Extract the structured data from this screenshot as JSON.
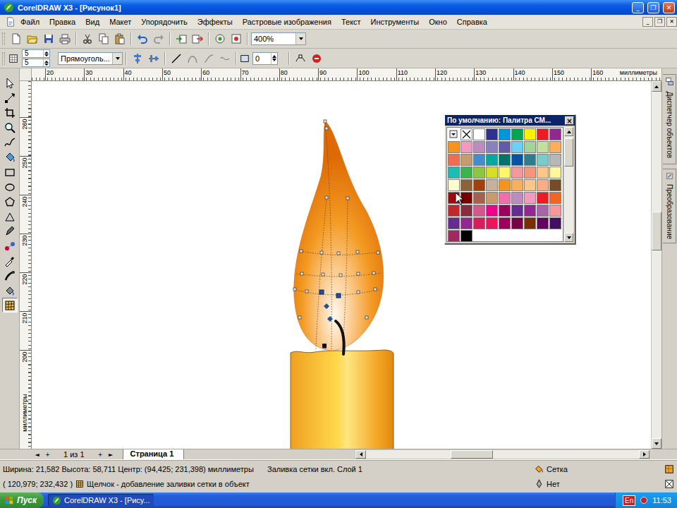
{
  "window": {
    "title": "CorelDRAW X3 - [Рисунок1]",
    "controls": [
      "_",
      "❐",
      "✕"
    ]
  },
  "menu": {
    "items": [
      "Файл",
      "Правка",
      "Вид",
      "Макет",
      "Упорядочить",
      "Эффекты",
      "Растровые изображения",
      "Текст",
      "Инструменты",
      "Окно",
      "Справка"
    ],
    "doc_controls": [
      "_",
      "❐",
      "✕"
    ]
  },
  "toolbar": {
    "zoom": "400%"
  },
  "property_bar": {
    "width_field": "5",
    "height_field": "5",
    "shape": "Прямоуголь...",
    "angle": "0"
  },
  "rulers": {
    "horizontal": [
      "20",
      "30",
      "40",
      "50",
      "60",
      "70",
      "80",
      "90",
      "100",
      "110",
      "120",
      "130",
      "140",
      "150",
      "160"
    ],
    "horizontal_unit": "миллиметры",
    "vertical": [
      "260",
      "250",
      "240",
      "230",
      "220",
      "210",
      "200"
    ],
    "vertical_unit": "миллиметры"
  },
  "toolbox": [
    {
      "selected": false
    },
    {
      "selected": false
    },
    {
      "selected": false
    },
    {
      "selected": false
    },
    {
      "selected": false
    },
    {
      "selected": false
    },
    {
      "selected": false
    },
    {
      "selected": false
    },
    {
      "selected": false
    },
    {
      "selected": false
    },
    {
      "selected": false
    },
    {
      "selected": false
    },
    {
      "selected": false
    },
    {
      "selected": false
    },
    {
      "selected": false
    },
    {
      "selected": true
    }
  ],
  "palette": {
    "title": "По умолчанию: Палитра СМ...",
    "close": "×",
    "swatches": [
      {
        "kind": "picker"
      },
      {
        "kind": "none"
      },
      {
        "kind": "color",
        "color": "#ffffff"
      },
      {
        "kind": "color",
        "color": "#2e3192"
      },
      {
        "kind": "color",
        "color": "#0096db"
      },
      {
        "kind": "color",
        "color": "#00a651"
      },
      {
        "kind": "color",
        "color": "#fff200"
      },
      {
        "kind": "color",
        "color": "#ed1c24"
      },
      {
        "kind": "color",
        "color": "#92278f"
      },
      {
        "kind": "color",
        "color": "#f7941d"
      },
      {
        "kind": "color",
        "color": "#f49ac1"
      },
      {
        "kind": "color",
        "color": "#bd8cbf"
      },
      {
        "kind": "color",
        "color": "#8781bd"
      },
      {
        "kind": "color",
        "color": "#605ca8"
      },
      {
        "kind": "color",
        "color": "#6dcff6"
      },
      {
        "kind": "color",
        "color": "#a3d39c"
      },
      {
        "kind": "color",
        "color": "#c4df9b"
      },
      {
        "kind": "color",
        "color": "#fbaf5d"
      },
      {
        "kind": "color",
        "color": "#f26c4f"
      },
      {
        "kind": "color",
        "color": "#c69c6d"
      },
      {
        "kind": "color",
        "color": "#448ccb"
      },
      {
        "kind": "color",
        "color": "#00a99d"
      },
      {
        "kind": "color",
        "color": "#00746b"
      },
      {
        "kind": "color",
        "color": "#0054a6"
      },
      {
        "kind": "color",
        "color": "#2e7d8c"
      },
      {
        "kind": "color",
        "color": "#7accc8"
      },
      {
        "kind": "color",
        "color": "#b7b7b7"
      },
      {
        "kind": "color",
        "color": "#1cbbb4"
      },
      {
        "kind": "color",
        "color": "#39b54a"
      },
      {
        "kind": "color",
        "color": "#8dc63f"
      },
      {
        "kind": "color",
        "color": "#d7df23"
      },
      {
        "kind": "color",
        "color": "#fff568"
      },
      {
        "kind": "color",
        "color": "#f5989d"
      },
      {
        "kind": "color",
        "color": "#f69679"
      },
      {
        "kind": "color",
        "color": "#fdc689"
      },
      {
        "kind": "color",
        "color": "#fff799"
      },
      {
        "kind": "color",
        "color": "#fffbd0"
      },
      {
        "kind": "color",
        "color": "#8c6239"
      },
      {
        "kind": "color",
        "color": "#a0410d"
      },
      {
        "kind": "color",
        "color": "#c7b299"
      },
      {
        "kind": "color",
        "color": "#f7941d"
      },
      {
        "kind": "color",
        "color": "#fbaf5d"
      },
      {
        "kind": "color",
        "color": "#fdc689"
      },
      {
        "kind": "color",
        "color": "#f9ad81"
      },
      {
        "kind": "color",
        "color": "#754c24"
      },
      {
        "kind": "color",
        "color": "#9e0b0f"
      },
      {
        "kind": "color",
        "color": "#790000"
      },
      {
        "kind": "color",
        "color": "#a3624d"
      },
      {
        "kind": "color",
        "color": "#c69c6d"
      },
      {
        "kind": "color",
        "color": "#f06eaa"
      },
      {
        "kind": "color",
        "color": "#bd8cbf"
      },
      {
        "kind": "color",
        "color": "#f49ac1"
      },
      {
        "kind": "color",
        "color": "#ed1c24"
      },
      {
        "kind": "color",
        "color": "#f26522"
      },
      {
        "kind": "color",
        "color": "#c1272d"
      },
      {
        "kind": "color",
        "color": "#8a2c3f"
      },
      {
        "kind": "color",
        "color": "#d4578e"
      },
      {
        "kind": "color",
        "color": "#ec008c"
      },
      {
        "kind": "color",
        "color": "#9e005d"
      },
      {
        "kind": "color",
        "color": "#662d91"
      },
      {
        "kind": "color",
        "color": "#92278f"
      },
      {
        "kind": "color",
        "color": "#a864a8"
      },
      {
        "kind": "color",
        "color": "#f5989d"
      },
      {
        "kind": "color",
        "color": "#662d91"
      },
      {
        "kind": "color",
        "color": "#92278f"
      },
      {
        "kind": "color",
        "color": "#d91c5c"
      },
      {
        "kind": "color",
        "color": "#ed145b"
      },
      {
        "kind": "color",
        "color": "#9e005d"
      },
      {
        "kind": "color",
        "color": "#790046"
      },
      {
        "kind": "color",
        "color": "#7b2e00"
      },
      {
        "kind": "color",
        "color": "#630460"
      },
      {
        "kind": "color",
        "color": "#440e62"
      },
      {
        "kind": "color",
        "color": "#a0295f"
      },
      {
        "kind": "color",
        "color": "#000000"
      }
    ]
  },
  "dockers": [
    {
      "label": "Диспетчер объектов",
      "selected": false
    },
    {
      "label": "Преобразование",
      "selected": false
    }
  ],
  "page_nav": {
    "buttons_left": [
      "◄",
      "+"
    ],
    "counter": "1 из 1",
    "buttons_right": [
      "+",
      "►"
    ],
    "tabs": [
      {
        "label": "Страница 1",
        "selected": true
      }
    ]
  },
  "status_bar": {
    "size": "Ширина: 21,582 Высота: 58,711 Центр: (94,425; 231,398) миллиметры",
    "mode": "Заливка сетки вкл. Слой 1",
    "fill": "Сетка",
    "outline": "Нет",
    "cursor": "( 120,979; 232,432 )",
    "hint": "Щелчок - добавление заливки сетки в объект"
  },
  "taskbar": {
    "start": "Пуск",
    "tasks": [
      {
        "label": "CorelDRAW X3 - [Рису...",
        "selected": true
      }
    ],
    "language": "En",
    "clock": "11:53"
  }
}
